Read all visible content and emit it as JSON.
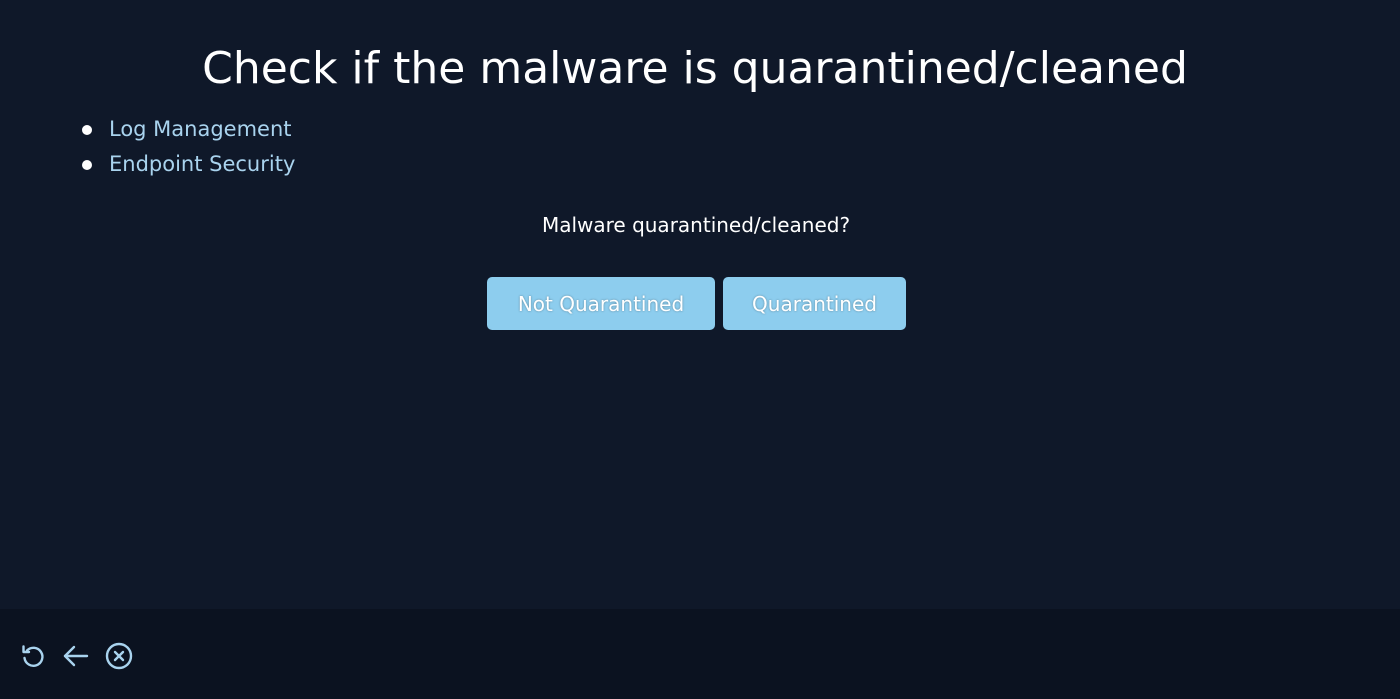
{
  "page": {
    "title": "Check if the malware is quarantined/cleaned"
  },
  "links": [
    {
      "label": "Log Management"
    },
    {
      "label": "Endpoint Security"
    }
  ],
  "question": {
    "text": "Malware quarantined/cleaned?"
  },
  "buttons": {
    "not_quarantined": "Not Quarantined",
    "quarantined": "Quarantined"
  },
  "footer": {
    "icons": [
      "restart-icon",
      "back-arrow-icon",
      "close-circle-icon"
    ]
  },
  "colors": {
    "background": "#0f1829",
    "footer_background": "#0b1220",
    "link": "#a9d3ee",
    "button": "#8dcdee",
    "text": "#ffffff"
  }
}
